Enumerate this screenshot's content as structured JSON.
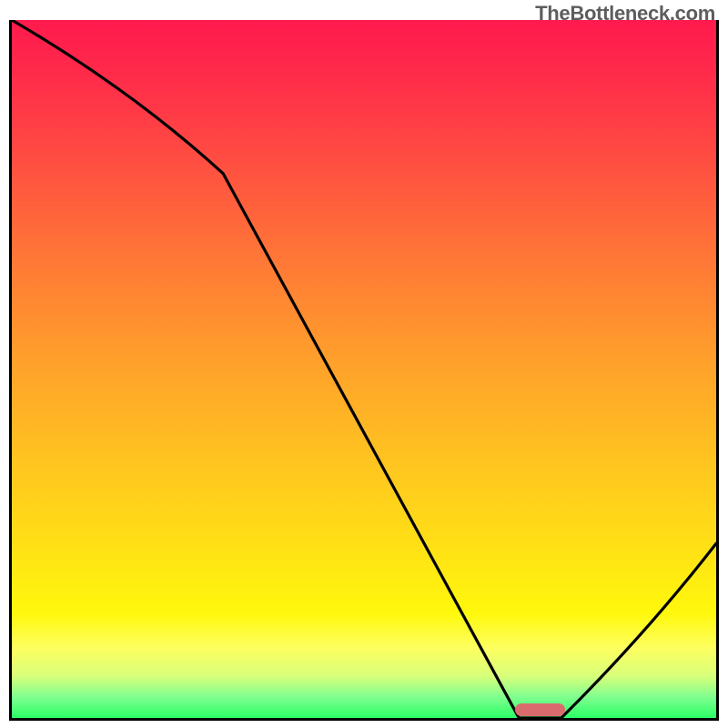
{
  "watermark": "TheBottleneck.com",
  "chart_data": {
    "type": "line",
    "title": "",
    "xlabel": "",
    "ylabel": "",
    "x": [
      0,
      0.3,
      0.72,
      0.78,
      1.0
    ],
    "values": [
      1.0,
      0.78,
      0.0,
      0.0,
      0.25
    ],
    "xlim": [
      0,
      1
    ],
    "ylim": [
      0,
      1
    ],
    "marker_x_range": [
      0.72,
      0.78
    ],
    "gradient_stops": [
      {
        "pos": 0.0,
        "color": "#ff1a4d"
      },
      {
        "pos": 0.5,
        "color": "#ffa32a"
      },
      {
        "pos": 0.85,
        "color": "#fff80c"
      },
      {
        "pos": 1.0,
        "color": "#2bff66"
      }
    ]
  }
}
